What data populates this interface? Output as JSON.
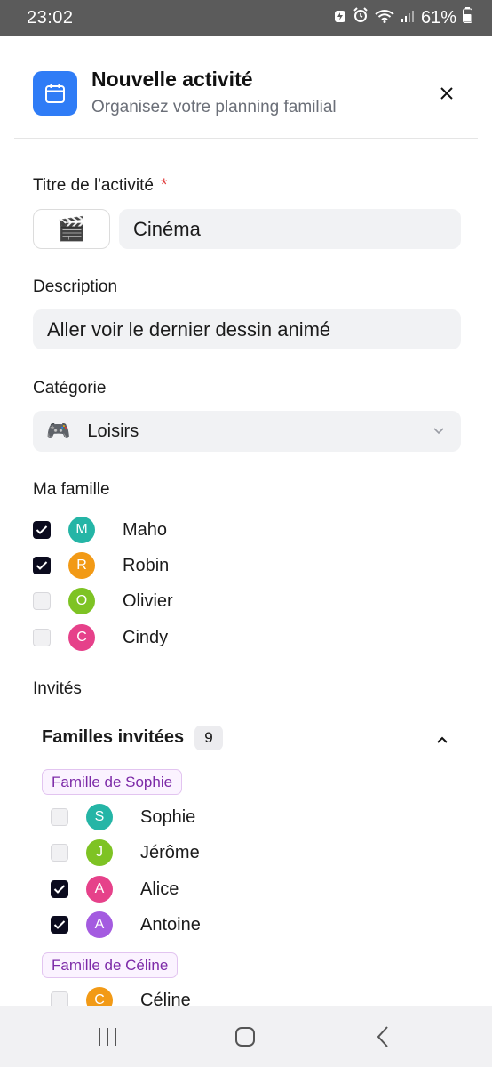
{
  "status_bar": {
    "time": "23:02",
    "battery": "61%"
  },
  "header": {
    "icon": "calendar-icon",
    "title": "Nouvelle activité",
    "subtitle": "Organisez votre planning familial"
  },
  "form": {
    "title_label": "Titre de l'activité",
    "required_mark": "*",
    "title_emoji": "🎬",
    "title_value": "Cinéma",
    "description_label": "Description",
    "description_value": "Aller voir le dernier dessin animé",
    "category_label": "Catégorie",
    "category_emoji": "🎮",
    "category_value": "Loisirs"
  },
  "family": {
    "label": "Ma famille",
    "members": [
      {
        "initial": "M",
        "name": "Maho",
        "checked": true,
        "color": "#25b5a6"
      },
      {
        "initial": "R",
        "name": "Robin",
        "checked": true,
        "color": "#f29a16"
      },
      {
        "initial": "O",
        "name": "Olivier",
        "checked": false,
        "color": "#7ec324"
      },
      {
        "initial": "C",
        "name": "Cindy",
        "checked": false,
        "color": "#e6418a"
      }
    ]
  },
  "guests": {
    "label": "Invités",
    "section_title": "Familles invitées",
    "count": "9",
    "families": [
      {
        "name": "Famille de Sophie",
        "members": [
          {
            "initial": "S",
            "name": "Sophie",
            "checked": false,
            "color": "#25b5a6"
          },
          {
            "initial": "J",
            "name": "Jérôme",
            "checked": false,
            "color": "#7ec324"
          },
          {
            "initial": "A",
            "name": "Alice",
            "checked": true,
            "color": "#e6418a"
          },
          {
            "initial": "A",
            "name": "Antoine",
            "checked": true,
            "color": "#a45be0"
          }
        ]
      },
      {
        "name": "Famille de Céline",
        "members": [
          {
            "initial": "C",
            "name": "Céline",
            "checked": false,
            "color": "#f29a16"
          }
        ]
      }
    ]
  },
  "colors": {
    "accent": "#2f7cf6",
    "checkbox_on": "#0b0b1e",
    "required": "#e03b3b",
    "family_tag_text": "#7d2ba8"
  }
}
